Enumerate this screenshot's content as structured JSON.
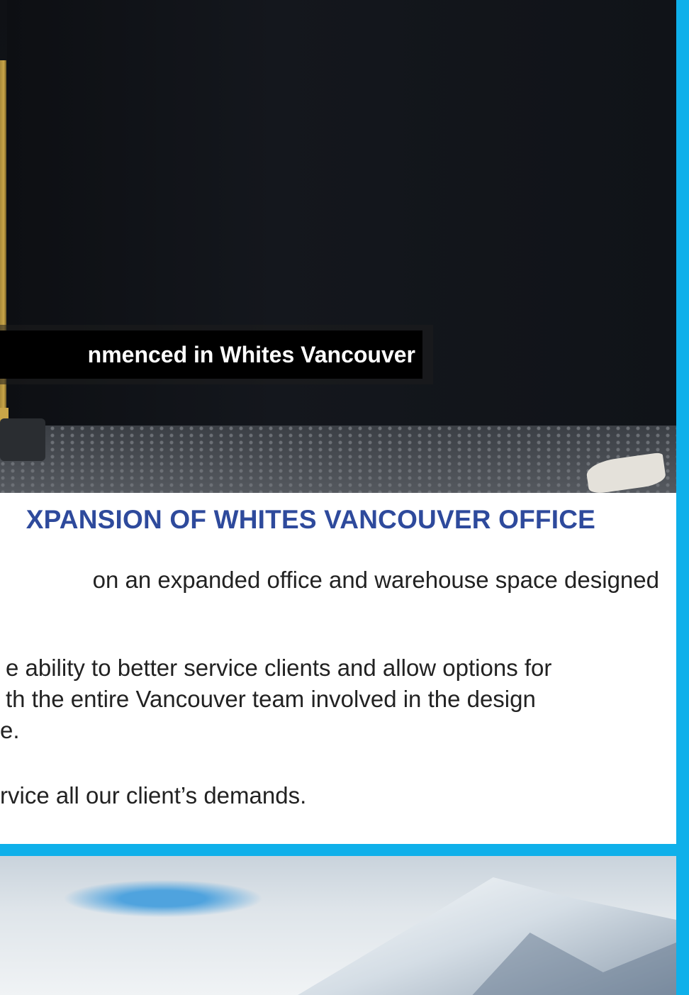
{
  "photo_top": {
    "caption": "nmenced in Whites Vancouver"
  },
  "article": {
    "heading": "XPANSION OF WHITES VANCOUVER OFFICE",
    "paragraph1": {
      "line1": "on an expanded office and warehouse space designed"
    },
    "paragraph2": {
      "line1": "e ability to better service clients and allow options for",
      "line2": "th the entire Vancouver team involved in the design",
      "line3": "e."
    },
    "paragraph3": {
      "line1": "rvice all our client’s demands."
    }
  },
  "colors": {
    "frame": "#0fb0ea",
    "heading": "#2e4a9c"
  }
}
